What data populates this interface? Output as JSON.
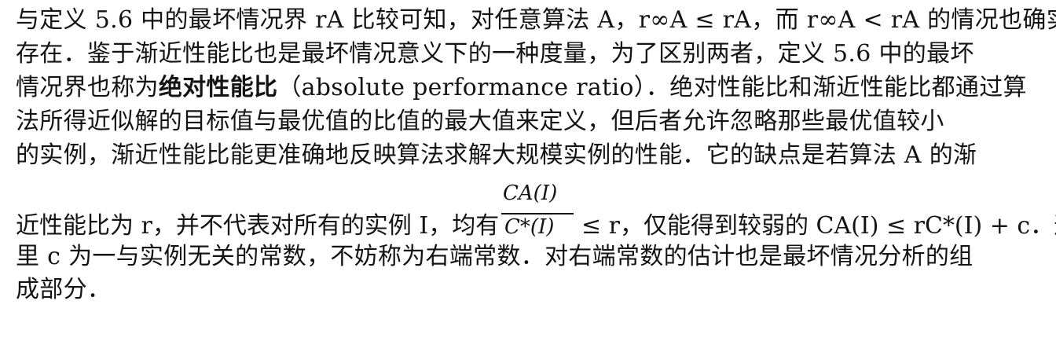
{
  "paragraph": {
    "line1": "与定义 5.6 中的最坏情况界 rA 比较可知，对任意算法 A，r∞A ≤ rA，而 r∞A < rA 的情况也确实",
    "line2": "存在．鉴于渐近性能比也是最坏情况意义下的一种度量，为了区别两者，定义 5.6 中的最坏",
    "line3_pre": "情况界也称为",
    "line3_term": "绝对性能比",
    "line3_post": "（absolute performance ratio）．绝对性能比和渐近性能比都通过算",
    "line4": "法所得近似解的目标值与最优值的比值的最大值来定义，但后者允许忽略那些最优值较小",
    "line5": "的实例，渐近性能比能更准确地反映算法求解大规模实例的性能．它的缺点是若算法 A 的渐",
    "line6_pre": "近性能比为 r，并不代表对所有的实例 I，均有",
    "frac_num": "CA(I)",
    "frac_den": "C*(I)",
    "line6_post": "≤ r，仅能得到较弱的 CA(I) ≤ rC*(I) + c．这",
    "line7": "里 c 为一与实例无关的常数，不妨称为右端常数．对右端常数的估计也是最坏情况分析的组",
    "line8": "成部分．"
  }
}
